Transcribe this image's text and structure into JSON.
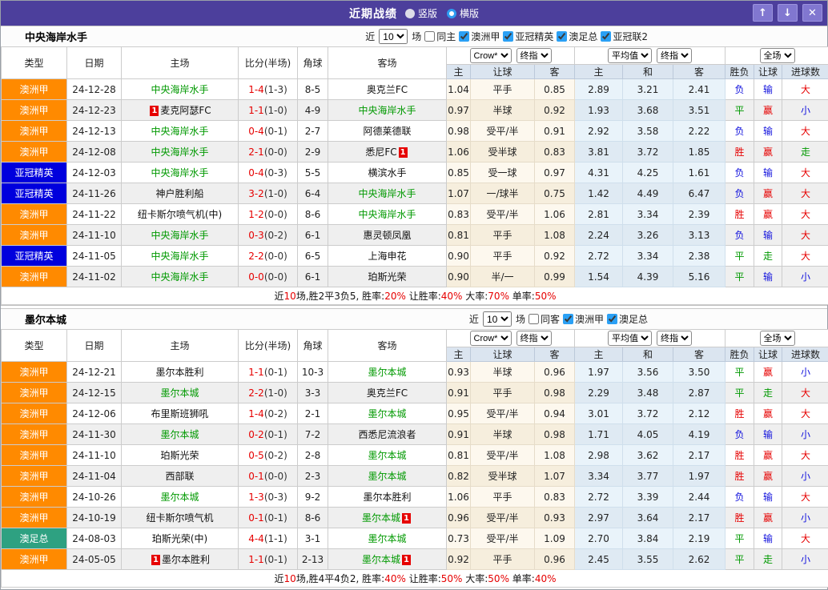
{
  "titlebar": {
    "title": "近期战绩",
    "view_radios": [
      {
        "label": "竖版",
        "style": "filled",
        "selected": true
      },
      {
        "label": "横版",
        "style": "ring",
        "selected": false
      }
    ],
    "window_buttons": [
      {
        "name": "move-up",
        "glyph": "↑"
      },
      {
        "name": "move-down",
        "glyph": "↓"
      },
      {
        "name": "close",
        "glyph": "✕"
      }
    ],
    "bg_color": "#4c3f9c"
  },
  "table_header": {
    "left_cols": [
      "类型",
      "日期",
      "主场",
      "比分(半场)",
      "角球",
      "客场"
    ],
    "odds_selects": [
      "Crow*",
      "终指"
    ],
    "odds_cols": [
      "主",
      "让球",
      "客"
    ],
    "avg_selects": [
      "平均值",
      "终指"
    ],
    "avg_cols": [
      "主",
      "和",
      "客"
    ],
    "result_selects": [
      "全场"
    ],
    "result_cols": [
      "胜负",
      "让球",
      "进球数"
    ]
  },
  "league_colors": {
    "澳洲甲": "#ff8a00",
    "亚冠精英": "#0000dd",
    "澳足总": "#2ea181"
  },
  "result_colors": {
    "胜": "#e60000",
    "负": "#1212dd",
    "平": "#009900",
    "赢": "#e60000",
    "输": "#1212dd",
    "走": "#009900",
    "大": "#e60000",
    "小": "#1212dd"
  },
  "sections": [
    {
      "team": "中央海岸水手",
      "filter": {
        "prefix": "近",
        "count": "10",
        "suffix": "场",
        "same_label": "同主",
        "same_checked": false,
        "leagues": [
          {
            "label": "澳洲甲",
            "checked": true
          },
          {
            "label": "亚冠精英",
            "checked": true
          },
          {
            "label": "澳足总",
            "checked": true
          },
          {
            "label": "亚冠联2",
            "checked": true
          }
        ]
      },
      "rows": [
        {
          "league": "澳洲甲",
          "date": "24-12-28",
          "home": {
            "name": "中央海岸水手",
            "green": true
          },
          "score": "1-4",
          "half": "(1-3)",
          "corners": "8-5",
          "away": {
            "name": "奥克兰FC",
            "green": false
          },
          "odds": [
            "1.04",
            "平手",
            "0.85"
          ],
          "avg": [
            "2.89",
            "3.21",
            "2.41"
          ],
          "results": [
            "负",
            "输",
            "大"
          ]
        },
        {
          "league": "澳洲甲",
          "date": "24-12-23",
          "home": {
            "name": "麦克阿瑟FC",
            "green": false,
            "card": "1",
            "card_pos": "pre"
          },
          "score": "1-1",
          "half": "(1-0)",
          "corners": "4-9",
          "away": {
            "name": "中央海岸水手",
            "green": true
          },
          "odds": [
            "0.97",
            "半球",
            "0.92"
          ],
          "avg": [
            "1.93",
            "3.68",
            "3.51"
          ],
          "results": [
            "平",
            "赢",
            "小"
          ]
        },
        {
          "league": "澳洲甲",
          "date": "24-12-13",
          "home": {
            "name": "中央海岸水手",
            "green": true
          },
          "score": "0-4",
          "half": "(0-1)",
          "corners": "2-7",
          "away": {
            "name": "阿德莱德联",
            "green": false
          },
          "odds": [
            "0.98",
            "受平/半",
            "0.91"
          ],
          "avg": [
            "2.92",
            "3.58",
            "2.22"
          ],
          "results": [
            "负",
            "输",
            "大"
          ]
        },
        {
          "league": "澳洲甲",
          "date": "24-12-08",
          "home": {
            "name": "中央海岸水手",
            "green": true
          },
          "score": "2-1",
          "half": "(0-0)",
          "corners": "2-9",
          "away": {
            "name": "悉尼FC",
            "green": false,
            "card": "1",
            "card_pos": "post"
          },
          "odds": [
            "1.06",
            "受半球",
            "0.83"
          ],
          "avg": [
            "3.81",
            "3.72",
            "1.85"
          ],
          "results": [
            "胜",
            "赢",
            "走"
          ]
        },
        {
          "league": "亚冠精英",
          "date": "24-12-03",
          "home": {
            "name": "中央海岸水手",
            "green": true
          },
          "score": "0-4",
          "half": "(0-3)",
          "corners": "5-5",
          "away": {
            "name": "横滨水手",
            "green": false
          },
          "odds": [
            "0.85",
            "受一球",
            "0.97"
          ],
          "avg": [
            "4.31",
            "4.25",
            "1.61"
          ],
          "results": [
            "负",
            "输",
            "大"
          ]
        },
        {
          "league": "亚冠精英",
          "date": "24-11-26",
          "home": {
            "name": "神户胜利船",
            "green": false
          },
          "score": "3-2",
          "half": "(1-0)",
          "corners": "6-4",
          "away": {
            "name": "中央海岸水手",
            "green": true
          },
          "odds": [
            "1.07",
            "一/球半",
            "0.75"
          ],
          "avg": [
            "1.42",
            "4.49",
            "6.47"
          ],
          "results": [
            "负",
            "赢",
            "大"
          ]
        },
        {
          "league": "澳洲甲",
          "date": "24-11-22",
          "home": {
            "name": "纽卡斯尔喷气机(中)",
            "green": false
          },
          "score": "1-2",
          "half": "(0-0)",
          "corners": "8-6",
          "away": {
            "name": "中央海岸水手",
            "green": true
          },
          "odds": [
            "0.83",
            "受平/半",
            "1.06"
          ],
          "avg": [
            "2.81",
            "3.34",
            "2.39"
          ],
          "results": [
            "胜",
            "赢",
            "大"
          ]
        },
        {
          "league": "澳洲甲",
          "date": "24-11-10",
          "home": {
            "name": "中央海岸水手",
            "green": true
          },
          "score": "0-3",
          "half": "(0-2)",
          "corners": "6-1",
          "away": {
            "name": "惠灵顿凤凰",
            "green": false
          },
          "odds": [
            "0.81",
            "平手",
            "1.08"
          ],
          "avg": [
            "2.24",
            "3.26",
            "3.13"
          ],
          "results": [
            "负",
            "输",
            "大"
          ]
        },
        {
          "league": "亚冠精英",
          "date": "24-11-05",
          "home": {
            "name": "中央海岸水手",
            "green": true
          },
          "score": "2-2",
          "half": "(0-0)",
          "corners": "6-5",
          "away": {
            "name": "上海申花",
            "green": false
          },
          "odds": [
            "0.90",
            "平手",
            "0.92"
          ],
          "avg": [
            "2.72",
            "3.34",
            "2.38"
          ],
          "results": [
            "平",
            "走",
            "大"
          ]
        },
        {
          "league": "澳洲甲",
          "date": "24-11-02",
          "home": {
            "name": "中央海岸水手",
            "green": true
          },
          "score": "0-0",
          "half": "(0-0)",
          "corners": "6-1",
          "away": {
            "name": "珀斯光荣",
            "green": false
          },
          "odds": [
            "0.90",
            "半/一",
            "0.99"
          ],
          "avg": [
            "1.54",
            "4.39",
            "5.16"
          ],
          "results": [
            "平",
            "输",
            "小"
          ]
        }
      ],
      "summary_parts": [
        {
          "text": "近",
          "red": false
        },
        {
          "text": "10",
          "red": true
        },
        {
          "text": "场,胜2平3负5, 胜率:",
          "red": false
        },
        {
          "text": "20%",
          "red": true
        },
        {
          "text": " 让胜率:",
          "red": false
        },
        {
          "text": "40%",
          "red": true
        },
        {
          "text": " 大率:",
          "red": false
        },
        {
          "text": "70%",
          "red": true
        },
        {
          "text": " 单率:",
          "red": false
        },
        {
          "text": "50%",
          "red": true
        }
      ]
    },
    {
      "team": "墨尔本城",
      "filter": {
        "prefix": "近",
        "count": "10",
        "suffix": "场",
        "same_label": "同客",
        "same_checked": false,
        "leagues": [
          {
            "label": "澳洲甲",
            "checked": true
          },
          {
            "label": "澳足总",
            "checked": true
          }
        ]
      },
      "rows": [
        {
          "league": "澳洲甲",
          "date": "24-12-21",
          "home": {
            "name": "墨尔本胜利",
            "green": false
          },
          "score": "1-1",
          "half": "(0-1)",
          "corners": "10-3",
          "away": {
            "name": "墨尔本城",
            "green": true
          },
          "odds": [
            "0.93",
            "半球",
            "0.96"
          ],
          "avg": [
            "1.97",
            "3.56",
            "3.50"
          ],
          "results": [
            "平",
            "赢",
            "小"
          ]
        },
        {
          "league": "澳洲甲",
          "date": "24-12-15",
          "home": {
            "name": "墨尔本城",
            "green": true
          },
          "score": "2-2",
          "half": "(1-0)",
          "corners": "3-3",
          "away": {
            "name": "奥克兰FC",
            "green": false
          },
          "odds": [
            "0.91",
            "平手",
            "0.98"
          ],
          "avg": [
            "2.29",
            "3.48",
            "2.87"
          ],
          "results": [
            "平",
            "走",
            "大"
          ]
        },
        {
          "league": "澳洲甲",
          "date": "24-12-06",
          "home": {
            "name": "布里斯班狮吼",
            "green": false
          },
          "score": "1-4",
          "half": "(0-2)",
          "corners": "2-1",
          "away": {
            "name": "墨尔本城",
            "green": true
          },
          "odds": [
            "0.95",
            "受平/半",
            "0.94"
          ],
          "avg": [
            "3.01",
            "3.72",
            "2.12"
          ],
          "results": [
            "胜",
            "赢",
            "大"
          ]
        },
        {
          "league": "澳洲甲",
          "date": "24-11-30",
          "home": {
            "name": "墨尔本城",
            "green": true
          },
          "score": "0-2",
          "half": "(0-1)",
          "corners": "7-2",
          "away": {
            "name": "西悉尼流浪者",
            "green": false
          },
          "odds": [
            "0.91",
            "半球",
            "0.98"
          ],
          "avg": [
            "1.71",
            "4.05",
            "4.19"
          ],
          "results": [
            "负",
            "输",
            "小"
          ]
        },
        {
          "league": "澳洲甲",
          "date": "24-11-10",
          "home": {
            "name": "珀斯光荣",
            "green": false
          },
          "score": "0-5",
          "half": "(0-2)",
          "corners": "2-8",
          "away": {
            "name": "墨尔本城",
            "green": true
          },
          "odds": [
            "0.81",
            "受平/半",
            "1.08"
          ],
          "avg": [
            "2.98",
            "3.62",
            "2.17"
          ],
          "results": [
            "胜",
            "赢",
            "大"
          ]
        },
        {
          "league": "澳洲甲",
          "date": "24-11-04",
          "home": {
            "name": "西部联",
            "green": false
          },
          "score": "0-1",
          "half": "(0-0)",
          "corners": "2-3",
          "away": {
            "name": "墨尔本城",
            "green": true
          },
          "odds": [
            "0.82",
            "受半球",
            "1.07"
          ],
          "avg": [
            "3.34",
            "3.77",
            "1.97"
          ],
          "results": [
            "胜",
            "赢",
            "小"
          ]
        },
        {
          "league": "澳洲甲",
          "date": "24-10-26",
          "home": {
            "name": "墨尔本城",
            "green": true
          },
          "score": "1-3",
          "half": "(0-3)",
          "corners": "9-2",
          "away": {
            "name": "墨尔本胜利",
            "green": false
          },
          "odds": [
            "1.06",
            "平手",
            "0.83"
          ],
          "avg": [
            "2.72",
            "3.39",
            "2.44"
          ],
          "results": [
            "负",
            "输",
            "大"
          ]
        },
        {
          "league": "澳洲甲",
          "date": "24-10-19",
          "home": {
            "name": "纽卡斯尔喷气机",
            "green": false
          },
          "score": "0-1",
          "half": "(0-1)",
          "corners": "8-6",
          "away": {
            "name": "墨尔本城",
            "green": true,
            "card": "1",
            "card_pos": "post"
          },
          "odds": [
            "0.96",
            "受平/半",
            "0.93"
          ],
          "avg": [
            "2.97",
            "3.64",
            "2.17"
          ],
          "results": [
            "胜",
            "赢",
            "小"
          ]
        },
        {
          "league": "澳足总",
          "date": "24-08-03",
          "home": {
            "name": "珀斯光荣(中)",
            "green": false
          },
          "score": "4-4",
          "half": "(1-1)",
          "corners": "3-1",
          "away": {
            "name": "墨尔本城",
            "green": true
          },
          "odds": [
            "0.73",
            "受平/半",
            "1.09"
          ],
          "avg": [
            "2.70",
            "3.84",
            "2.19"
          ],
          "results": [
            "平",
            "输",
            "大"
          ]
        },
        {
          "league": "澳洲甲",
          "date": "24-05-05",
          "home": {
            "name": "墨尔本胜利",
            "green": false,
            "card": "1",
            "card_pos": "pre"
          },
          "score": "1-1",
          "half": "(0-1)",
          "corners": "2-13",
          "away": {
            "name": "墨尔本城",
            "green": true,
            "card": "1",
            "card_pos": "post"
          },
          "odds": [
            "0.92",
            "平手",
            "0.96"
          ],
          "avg": [
            "2.45",
            "3.55",
            "2.62"
          ],
          "results": [
            "平",
            "走",
            "小"
          ]
        }
      ],
      "summary_parts": [
        {
          "text": "近",
          "red": false
        },
        {
          "text": "10",
          "red": true
        },
        {
          "text": "场,胜4平4负2, 胜率:",
          "red": false
        },
        {
          "text": "40%",
          "red": true
        },
        {
          "text": " 让胜率:",
          "red": false
        },
        {
          "text": "50%",
          "red": true
        },
        {
          "text": " 大率:",
          "red": false
        },
        {
          "text": "50%",
          "red": true
        },
        {
          "text": " 单率:",
          "red": false
        },
        {
          "text": "40%",
          "red": true
        }
      ]
    }
  ]
}
